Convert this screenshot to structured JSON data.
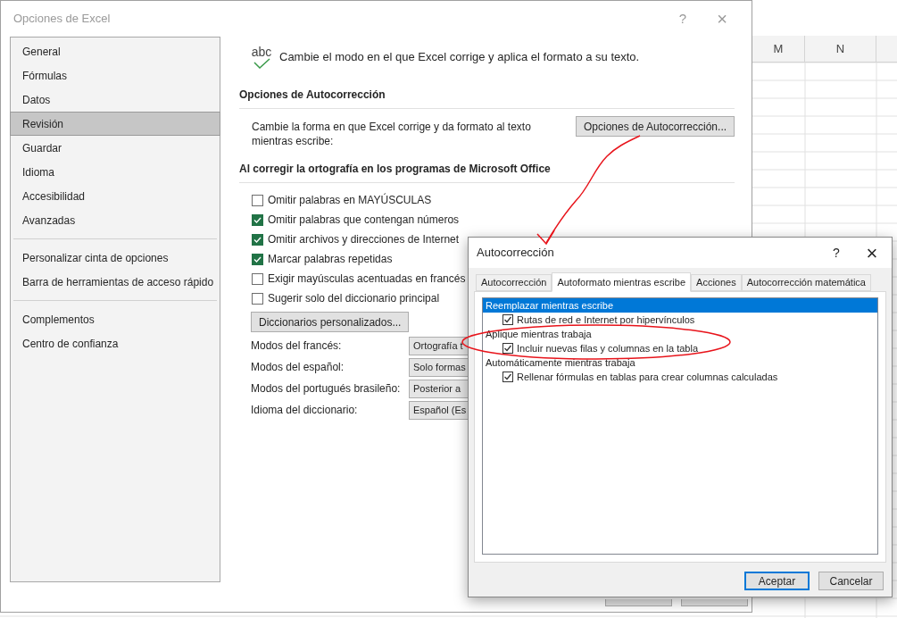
{
  "sheet": {
    "columns": [
      "M",
      "N"
    ]
  },
  "options_dialog": {
    "title": "Opciones de Excel",
    "help": "?",
    "close": "×",
    "nav_groups": [
      [
        {
          "label": "General",
          "selected": false
        },
        {
          "label": "Fórmulas",
          "selected": false
        },
        {
          "label": "Datos",
          "selected": false
        },
        {
          "label": "Revisión",
          "selected": true
        },
        {
          "label": "Guardar",
          "selected": false
        },
        {
          "label": "Idioma",
          "selected": false
        },
        {
          "label": "Accesibilidad",
          "selected": false
        },
        {
          "label": "Avanzadas",
          "selected": false
        }
      ],
      [
        {
          "label": "Personalizar cinta de opciones",
          "selected": false
        },
        {
          "label": "Barra de herramientas de acceso rápido",
          "selected": false
        }
      ],
      [
        {
          "label": "Complementos",
          "selected": false
        },
        {
          "label": "Centro de confianza",
          "selected": false
        }
      ]
    ],
    "intro": {
      "icon_text": "abc",
      "text": "Cambie el modo en el que Excel corrige y aplica el formato a su texto."
    },
    "autocorrect_section": {
      "heading": "Opciones de Autocorrección",
      "description": "Cambie la forma en que Excel corrige y da formato al texto mientras escribe:",
      "button": "Opciones de Autocorrección..."
    },
    "spelling_section": {
      "heading": "Al corregir la ortografía en los programas de Microsoft Office",
      "checkboxes": [
        {
          "label": "Omitir palabras en MAYÚSCULAS",
          "checked": false
        },
        {
          "label": "Omitir palabras que contengan números",
          "checked": true
        },
        {
          "label": "Omitir archivos y direcciones de Internet",
          "checked": true
        },
        {
          "label": "Marcar palabras repetidas",
          "checked": true
        },
        {
          "label": "Exigir mayúsculas acentuadas en francés",
          "checked": false
        },
        {
          "label": "Sugerir solo del diccionario principal",
          "checked": false
        }
      ],
      "button": "Diccionarios personalizados...",
      "modes": [
        {
          "label": "Modos del francés:",
          "value": "Ortografía t"
        },
        {
          "label": "Modos del español:",
          "value": "Solo formas"
        },
        {
          "label": "Modos del portugués brasileño:",
          "value": "Posterior a"
        },
        {
          "label": "Idioma del diccionario:",
          "value": "Español (Es"
        }
      ]
    }
  },
  "autocorrect_dialog": {
    "title": "Autocorrección",
    "help": "?",
    "close": "×",
    "tabs": [
      {
        "label": "Autocorrección",
        "selected": false
      },
      {
        "label": "Autoformato mientras escribe",
        "selected": true
      },
      {
        "label": "Acciones",
        "selected": false
      },
      {
        "label": "Autocorrección matemática",
        "selected": false
      }
    ],
    "list": [
      {
        "kind": "heading",
        "label": "Reemplazar mientras escribe",
        "selected": true
      },
      {
        "kind": "option",
        "label": "Rutas de red e Internet por hipervínculos",
        "checked": true
      },
      {
        "kind": "heading",
        "label": "Aplique mientras trabaja",
        "selected": false
      },
      {
        "kind": "option",
        "label": "Incluir nuevas filas y columnas en la tabla",
        "checked": true
      },
      {
        "kind": "heading",
        "label": "Automáticamente mientras trabaja",
        "selected": false
      },
      {
        "kind": "option",
        "label": "Rellenar fórmulas en tablas para crear columnas calculadas",
        "checked": true
      }
    ],
    "buttons": [
      {
        "label": "Aceptar",
        "default": true
      },
      {
        "label": "Cancelar",
        "default": false
      }
    ]
  }
}
